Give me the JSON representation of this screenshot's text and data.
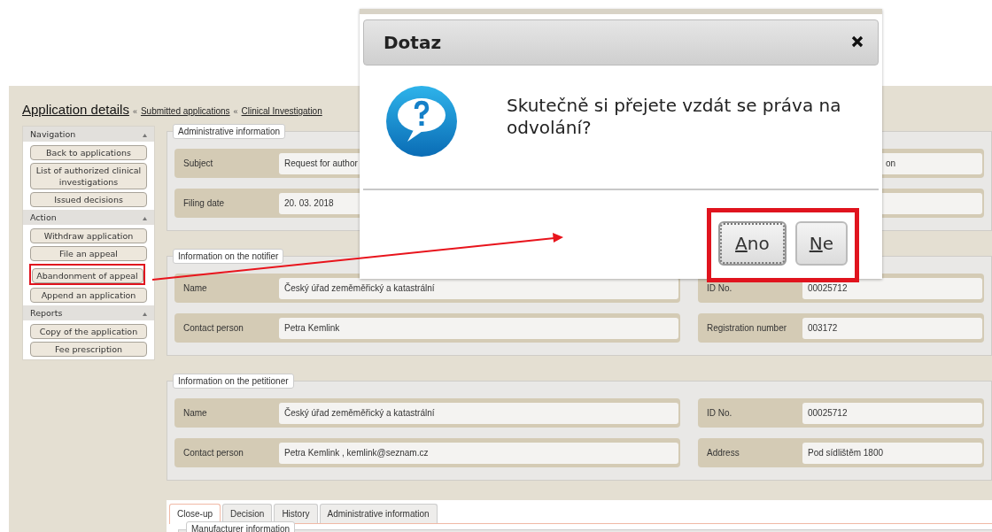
{
  "breadcrumb": {
    "title": "Application details",
    "links": [
      {
        "separator": "«",
        "label": "Submitted applications"
      },
      {
        "separator": "«",
        "label": "Clinical Investigation"
      }
    ]
  },
  "sidebar": {
    "sections": [
      {
        "title": "Navigation",
        "buttons": [
          {
            "label": "Back to applications",
            "annotated": false
          },
          {
            "label": "List of authorized clinical investigations",
            "annotated": false
          },
          {
            "label": "Issued decisions",
            "annotated": false
          }
        ]
      },
      {
        "title": "Action",
        "buttons": [
          {
            "label": "Withdraw application",
            "annotated": false
          },
          {
            "label": "File an appeal",
            "annotated": false
          },
          {
            "label": "Abandonment of appeal",
            "annotated": true
          },
          {
            "label": "Append an application",
            "annotated": false
          }
        ]
      },
      {
        "title": "Reports",
        "buttons": [
          {
            "label": "Copy of the application",
            "annotated": false
          },
          {
            "label": "Fee prescription",
            "annotated": false
          }
        ]
      }
    ]
  },
  "sections": [
    {
      "legend": "Administrative information",
      "rows": [
        {
          "label": "Subject",
          "value": "Request for author",
          "extra": "on"
        },
        {
          "label": "Filing date",
          "value": "20. 03. 2018"
        }
      ]
    },
    {
      "legend": "Information on the notifier",
      "rows": [
        {
          "label": "Name",
          "value": "Český úřad zeměměřický a katastrální",
          "right_label": "ID No.",
          "right_value": "00025712"
        },
        {
          "label": "Contact person",
          "value": "Petra Kemlink",
          "right_label": "Registration number",
          "right_value": "003172"
        }
      ]
    },
    {
      "legend": "Information on the petitioner",
      "rows": [
        {
          "label": "Name",
          "value": "Český úřad zeměměřický a katastrální",
          "right_label": "ID No.",
          "right_value": "00025712"
        },
        {
          "label": "Contact person",
          "value": "Petra Kemlink , kemlink@seznam.cz",
          "right_label": "Address",
          "right_value": "Pod sídlištěm 1800"
        }
      ]
    }
  ],
  "tabs": [
    {
      "label": "Close-up",
      "selected": true
    },
    {
      "label": "Decision",
      "selected": false
    },
    {
      "label": "History",
      "selected": false
    },
    {
      "label": "Administrative information",
      "selected": false
    }
  ],
  "tab_panel": {
    "legend": "Manufacturer information"
  },
  "dialog": {
    "title": "Dotaz",
    "message": "Skutečně si přejete vzdát se práva na odvolání?",
    "buttons_annotated": true,
    "buttons": [
      {
        "label": "Ano",
        "focused": true
      },
      {
        "label": "Ne",
        "focused": false
      }
    ]
  }
}
